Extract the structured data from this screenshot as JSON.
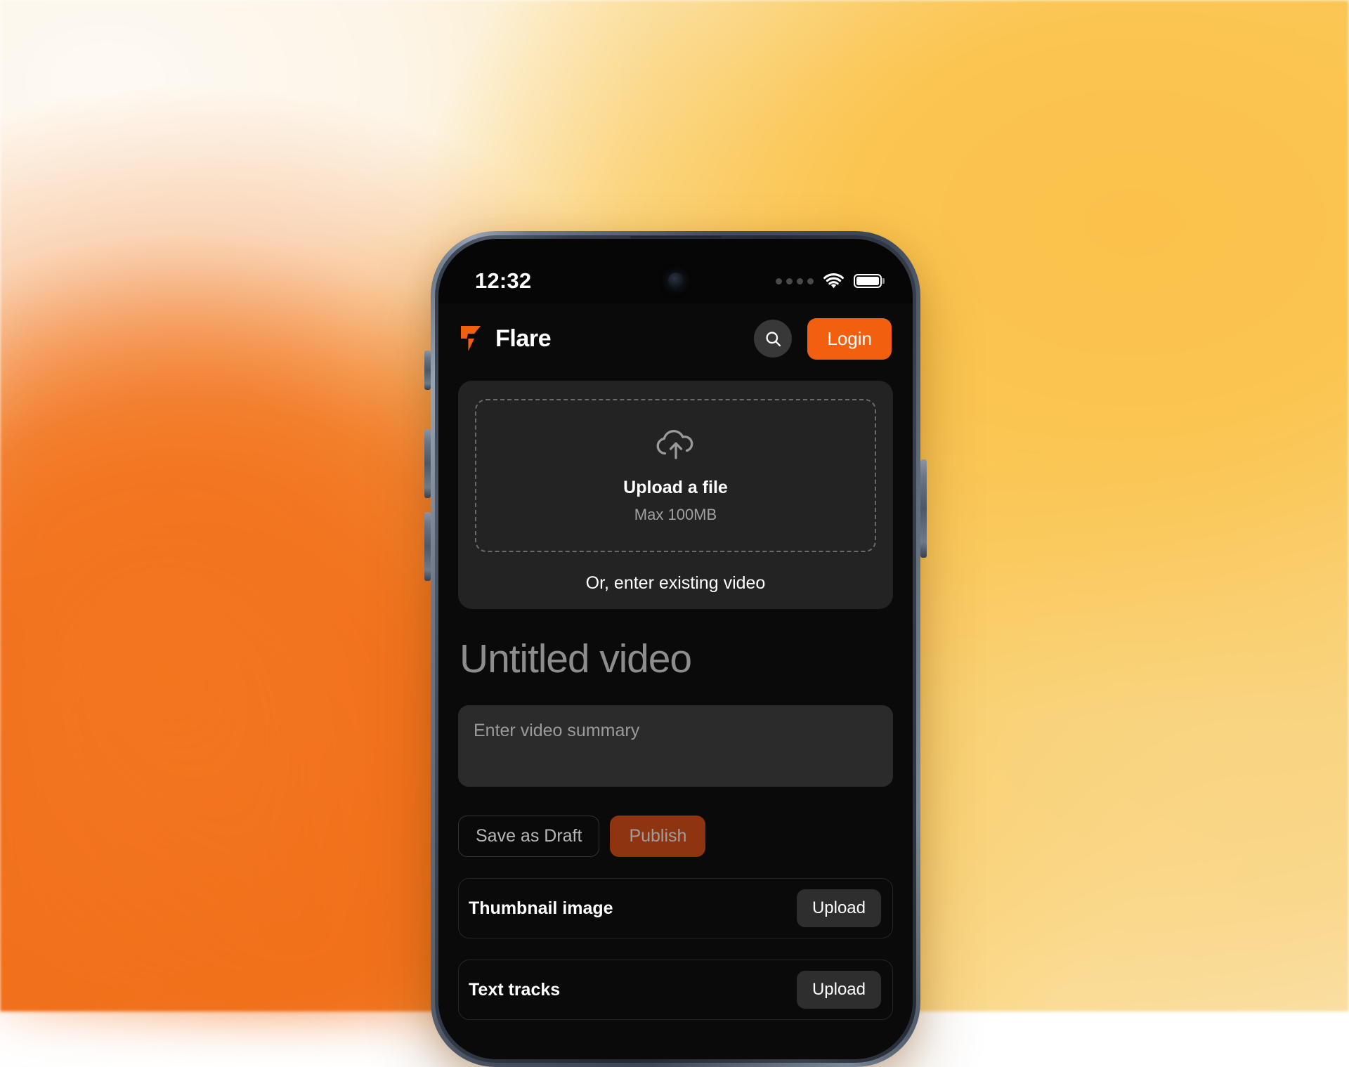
{
  "background": {
    "colors": {
      "cream": "#FDF6EC",
      "orange": "#F1701C",
      "gold": "#FBC550",
      "pale_gold": "#F9D37E"
    }
  },
  "device": {
    "frame_color": "#4A5361",
    "side_buttons": [
      "action-button",
      "volume-up-button",
      "volume-down-button",
      "power-button"
    ]
  },
  "status_bar": {
    "time": "12:32",
    "signal_icon": "signal-dots-icon",
    "wifi_icon": "wifi-icon",
    "battery_icon": "battery-full-icon",
    "camera_icon": "front-camera-lens"
  },
  "header": {
    "logo_icon": "flare-logo-icon",
    "brand": "Flare",
    "search_icon": "search-icon",
    "login_label": "Login",
    "accent_color": "#F2600F"
  },
  "upload": {
    "icon": "cloud-upload-icon",
    "title": "Upload a file",
    "subtitle": "Max 100MB",
    "alt_link": "Or, enter existing video"
  },
  "video": {
    "title_placeholder": "Untitled video",
    "summary_placeholder": "Enter video summary",
    "summary_value": ""
  },
  "actions": {
    "draft_label": "Save as Draft",
    "publish_label": "Publish",
    "publish_color": "#8E3410"
  },
  "assets": [
    {
      "label": "Thumbnail image",
      "button": "Upload"
    },
    {
      "label": "Text tracks",
      "button": "Upload"
    }
  ]
}
